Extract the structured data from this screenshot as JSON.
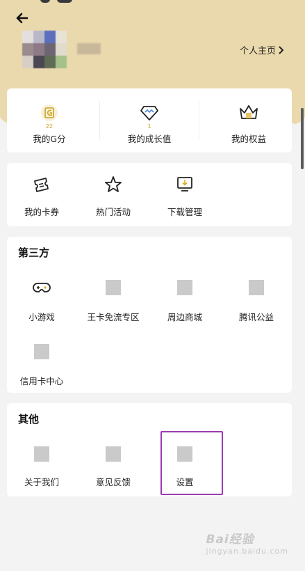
{
  "header": {
    "back_icon": "arrow-left-icon",
    "homepage_label": "个人主页",
    "homepage_icon": "chevron-right-icon"
  },
  "stats": [
    {
      "icon": "g-coin-icon",
      "value": "22",
      "label": "我的G分"
    },
    {
      "icon": "diamond-icon",
      "value": "1",
      "label": "我的成长值"
    },
    {
      "icon": "crown-icon",
      "label": "我的权益"
    }
  ],
  "tools": [
    {
      "icon": "ticket-icon",
      "label": "我的卡券"
    },
    {
      "icon": "star-icon",
      "label": "热门活动"
    },
    {
      "icon": "download-monitor-icon",
      "label": "下载管理"
    }
  ],
  "third_party": {
    "title": "第三方",
    "items": [
      {
        "icon": "gamepad-icon",
        "label": "小游戏"
      },
      {
        "icon": "placeholder-icon",
        "label": "王卡免流专区"
      },
      {
        "icon": "placeholder-icon",
        "label": "周边商城"
      },
      {
        "icon": "placeholder-icon",
        "label": "腾讯公益"
      },
      {
        "icon": "placeholder-icon",
        "label": "信用卡中心"
      }
    ]
  },
  "other": {
    "title": "其他",
    "items": [
      {
        "icon": "placeholder-icon",
        "label": "关于我们"
      },
      {
        "icon": "placeholder-icon",
        "label": "意见反馈"
      },
      {
        "icon": "placeholder-icon",
        "label": "设置"
      }
    ]
  },
  "colors": {
    "header_bg": "#ead9ad",
    "accent_gold": "#c9a21c",
    "highlight_border": "#9b3ab1"
  },
  "watermark": {
    "main": "Bai经验",
    "sub": "jingyan.baidu.com"
  }
}
